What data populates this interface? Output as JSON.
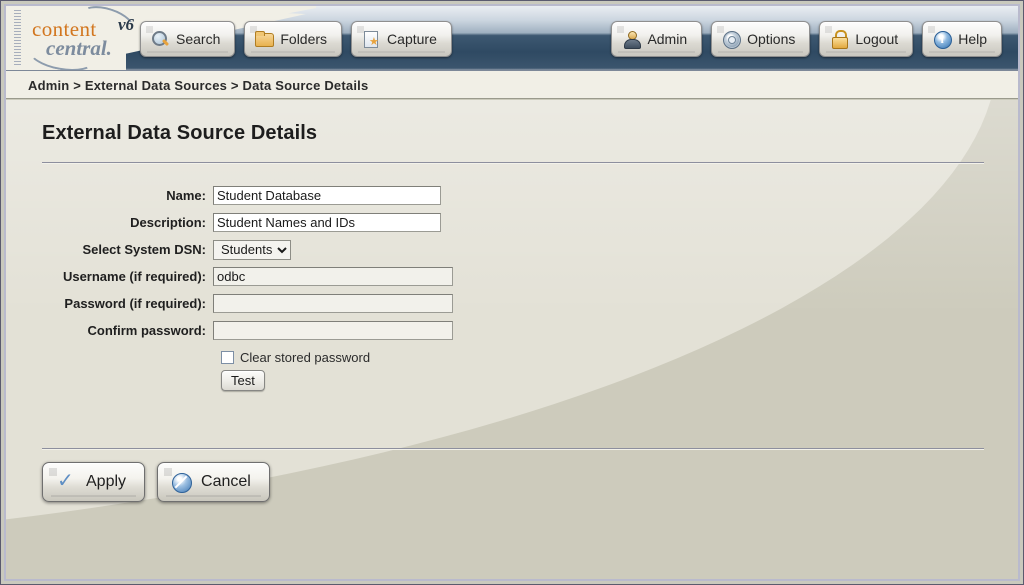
{
  "window": {
    "logo": {
      "word1": "content",
      "word2": "central.",
      "version": "v6"
    }
  },
  "toolbar": {
    "left": [
      {
        "label": "Search",
        "icon": "magnifier-icon"
      },
      {
        "label": "Folders",
        "icon": "folder-icon"
      },
      {
        "label": "Capture",
        "icon": "capture-icon"
      }
    ],
    "right": [
      {
        "label": "Admin",
        "icon": "user-icon"
      },
      {
        "label": "Options",
        "icon": "gear-icon"
      },
      {
        "label": "Logout",
        "icon": "lock-icon"
      },
      {
        "label": "Help",
        "icon": "info-icon"
      }
    ]
  },
  "breadcrumb": {
    "text": "Admin > External Data Sources > Data Source Details",
    "items": [
      "Admin",
      "External Data Sources",
      "Data Source Details"
    ],
    "separator": ">"
  },
  "page": {
    "title": "External Data Source Details"
  },
  "form": {
    "fields": [
      {
        "label": "Name:",
        "value": "Student Database",
        "placeholder": ""
      },
      {
        "label": "Description:",
        "value": "Student Names and IDs",
        "placeholder": ""
      },
      {
        "label": "Select System DSN:",
        "value": "Students",
        "options": [
          "Students"
        ]
      },
      {
        "label": "Username (if required):",
        "value": "odbc",
        "placeholder": ""
      },
      {
        "label": "Password (if required):",
        "value": "",
        "placeholder": ""
      },
      {
        "label": "Confirm password:",
        "value": "",
        "placeholder": ""
      }
    ],
    "checkbox": {
      "label": "Clear stored password",
      "checked": false
    },
    "test_button": "Test"
  },
  "footer": {
    "apply_label": "Apply",
    "cancel_label": "Cancel"
  },
  "colors": {
    "brand_orange": "#d2761f",
    "brand_slate": "#7d8c9e",
    "header_navy": "#2f4a63",
    "body_beige": "#cdcbbc",
    "crumb_bg": "#f1efe6"
  }
}
